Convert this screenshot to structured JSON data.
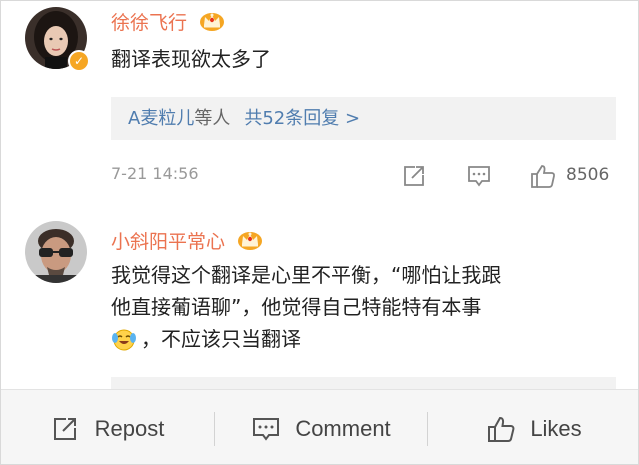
{
  "comments": [
    {
      "username": "徐徐飞行",
      "verified": true,
      "text": "翻译表现欲太多了",
      "replies": {
        "names": "A麦粒儿",
        "suffix": "等人",
        "count_label": "共52条回复 >"
      },
      "timestamp": "7-21 14:56",
      "likes": "8506"
    },
    {
      "username": "小斜阳平常心",
      "verified": false,
      "text_lines": [
        "我觉得这个翻译是心里不平衡，“哪怕让我跟",
        "他直接葡语聊”，他觉得自己特能特有本事",
        "，不应该只当翻译"
      ],
      "emoji": "laughing-crying-emoji"
    }
  ],
  "bottom_bar": {
    "repost_label": "Repost",
    "comment_label": "Comment",
    "likes_label": "Likes"
  },
  "icons": [
    "crown-icon",
    "verified-badge-icon",
    "share-icon",
    "comment-icon",
    "like-icon"
  ],
  "colors": {
    "username": "#eb7350",
    "link": "#507daf",
    "verified": "#f6a623",
    "meta": "#999999"
  }
}
